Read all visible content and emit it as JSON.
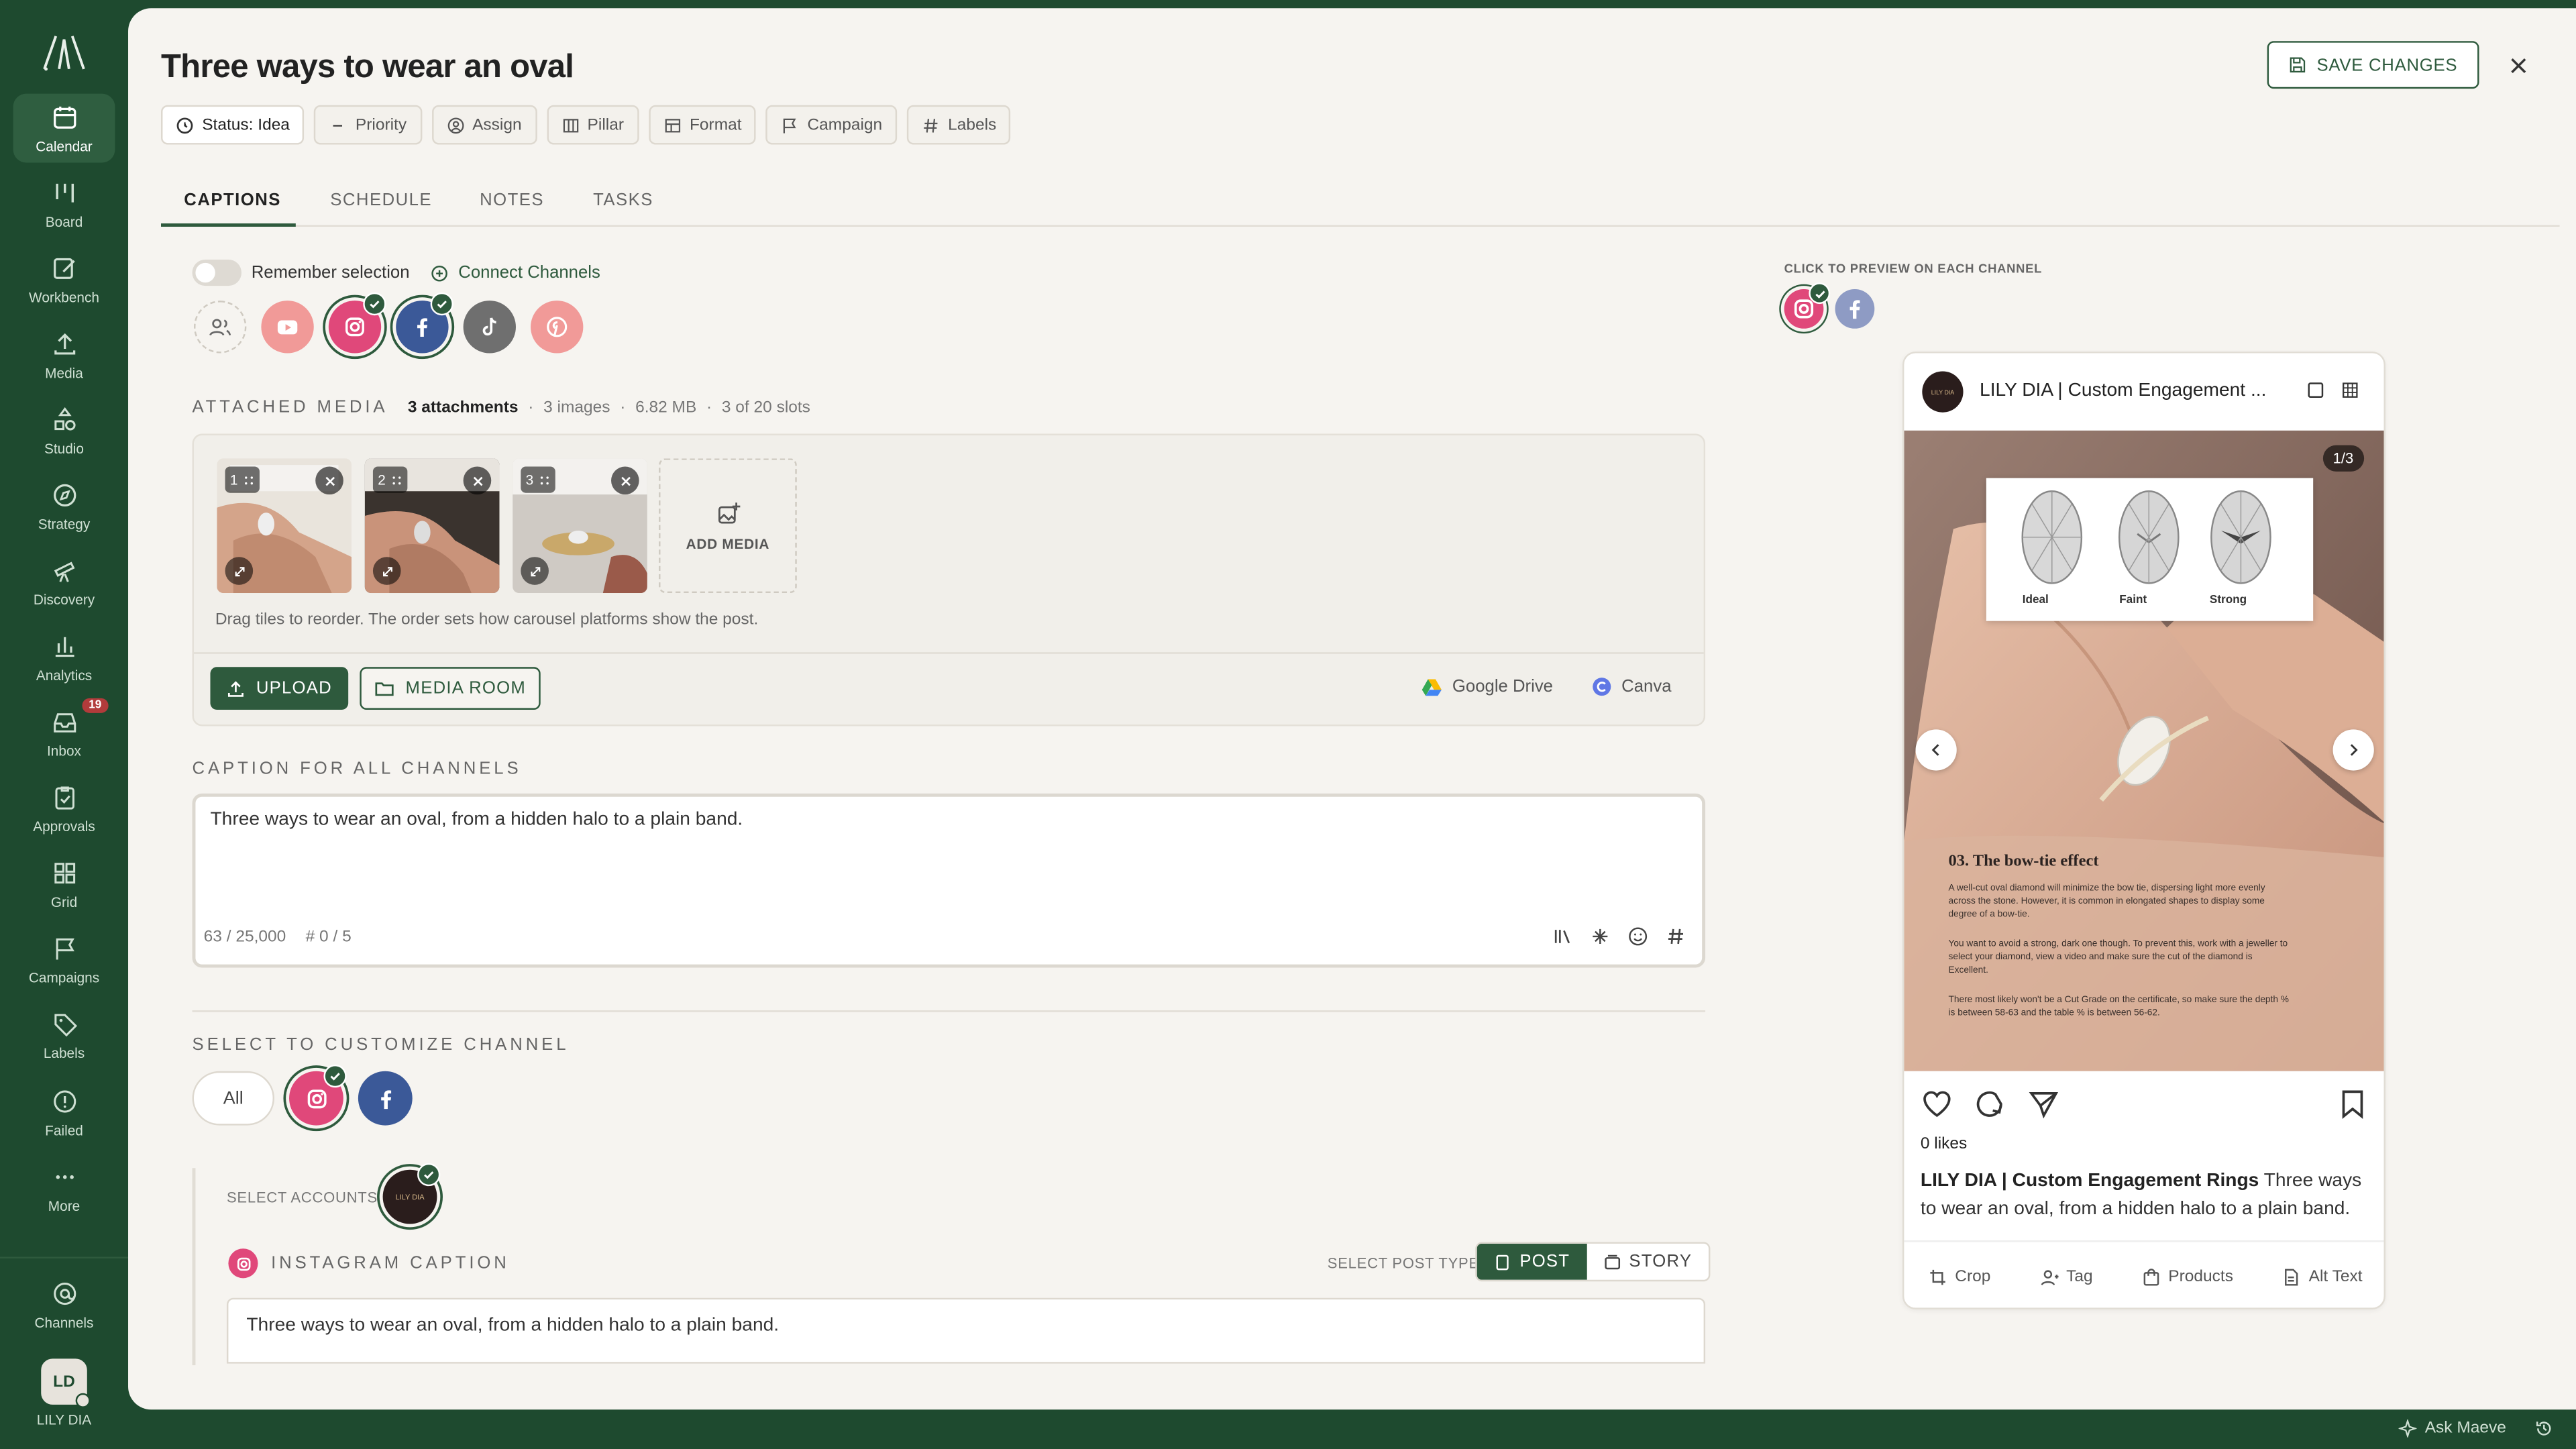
{
  "sidebar": {
    "items": [
      {
        "label": "Calendar",
        "icon": "calendar-icon"
      },
      {
        "label": "Board",
        "icon": "board-icon"
      },
      {
        "label": "Workbench",
        "icon": "workbench-icon"
      },
      {
        "label": "Media",
        "icon": "upload-icon"
      },
      {
        "label": "Studio",
        "icon": "studio-icon"
      },
      {
        "label": "Strategy",
        "icon": "compass-icon"
      },
      {
        "label": "Discovery",
        "icon": "telescope-icon"
      },
      {
        "label": "Analytics",
        "icon": "bar-chart-icon"
      },
      {
        "label": "Inbox",
        "icon": "inbox-icon",
        "badge": "19"
      },
      {
        "label": "Approvals",
        "icon": "clipboard-icon"
      },
      {
        "label": "Grid",
        "icon": "grid-icon"
      },
      {
        "label": "Campaigns",
        "icon": "flag-icon"
      },
      {
        "label": "Labels",
        "icon": "tag-icon"
      },
      {
        "label": "Failed",
        "icon": "alert-icon"
      },
      {
        "label": "More",
        "icon": "more-icon"
      }
    ],
    "channels_label": "Channels",
    "user_initials": "LD",
    "user_name": "LILY DIA"
  },
  "header": {
    "title": "Three ways to wear an oval",
    "save_label": "SAVE CHANGES",
    "chips": [
      "Status: Idea",
      "Priority",
      "Assign",
      "Pillar",
      "Format",
      "Campaign",
      "Labels"
    ]
  },
  "tabs": [
    "CAPTIONS",
    "SCHEDULE",
    "NOTES",
    "TASKS"
  ],
  "captions": {
    "remember_label": "Remember selection",
    "connect_label": "Connect Channels",
    "attached": {
      "label": "ATTACHED MEDIA",
      "count": "3 attachments",
      "images": "3 images",
      "size": "6.82 MB",
      "slots": "3 of 20 slots"
    },
    "thumb_numbers": [
      "1",
      "2",
      "3"
    ],
    "add_media": "ADD MEDIA",
    "drag_hint": "Drag tiles to reorder. The order sets how carousel platforms show the post.",
    "upload": "UPLOAD",
    "media_room": "MEDIA ROOM",
    "google_drive": "Google Drive",
    "canva": "Canva",
    "caption_label": "CAPTION FOR ALL CHANNELS",
    "caption_text": "Three ways to wear an oval, from a hidden halo to a plain band.",
    "char_count": "63 / 25,000",
    "hashtag_count": "# 0 / 5",
    "customize_label": "SELECT TO CUSTOMIZE CHANNEL",
    "all_pill": "All",
    "select_accounts": "SELECT ACCOUNTS",
    "account_avatar": "LILY DIA",
    "ig_caption_label": "INSTAGRAM CAPTION",
    "post_type_label": "SELECT POST TYPE",
    "post": "POST",
    "story": "STORY",
    "ig_caption_text": "Three ways to wear an oval, from a hidden halo to a plain band."
  },
  "preview": {
    "hint": "CLICK TO PREVIEW ON EACH CHANNEL",
    "account": "LILY DIA | Custom Engagement ...",
    "avatar_text": "LILY DIA",
    "counter": "1/3",
    "shapes": [
      "Ideal",
      "Faint",
      "Strong"
    ],
    "heading": "03. The bow-tie effect",
    "body": "A well-cut oval diamond will minimize the bow tie, dispersing light more evenly across the stone. However, it is common in elongated shapes to display some degree of a bow-tie.",
    "body2": "You want to avoid a strong, dark one though. To prevent this, work with a jeweller to select your diamond, view a video and make sure the cut of the diamond is Excellent.",
    "body3": "There most likely won't be a Cut Grade on the certificate, so make sure the depth % is between 58-63 and the table % is between 56-62.",
    "likes": "0 likes",
    "caption_account": "LILY DIA | Custom Engagement Rings",
    "caption_text": "Three ways to wear an oval, from a hidden halo to a plain band.",
    "actions": [
      "Crop",
      "Tag",
      "Products",
      "Alt Text"
    ]
  },
  "footer": {
    "ask": "Ask Maeve"
  },
  "colors": {
    "brand_green": "#1e4a2f",
    "accent_green": "#2e5a3d",
    "instagram": "#e0487a",
    "facebook": "#3b5998",
    "youtube": "#ef8a8a",
    "tiktok": "#6f6f6f",
    "pinterest": "#ef8a8a"
  }
}
